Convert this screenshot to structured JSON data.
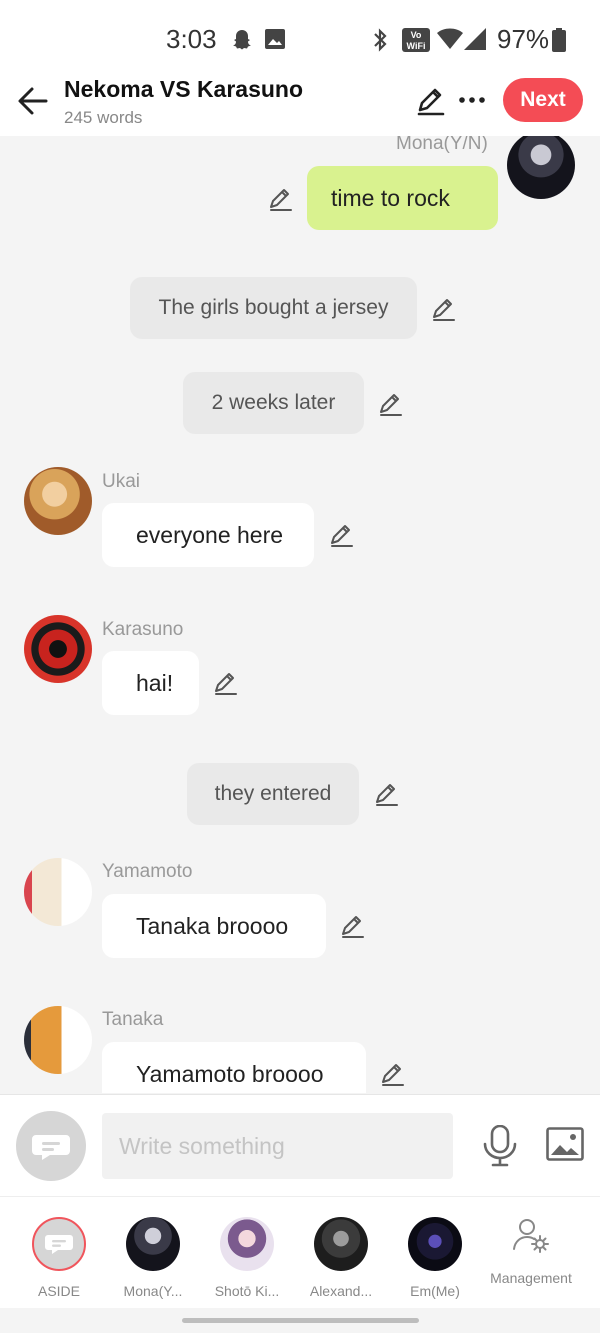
{
  "status": {
    "time": "3:03",
    "battery": "97%"
  },
  "header": {
    "title": "Nekoma VS Karasuno",
    "word_count": "245 words",
    "next_label": "Next"
  },
  "messages": {
    "m1": {
      "name": "Mona(Y/N)",
      "text": "time to rock"
    },
    "n1": {
      "text": "The girls bought a jersey"
    },
    "n2": {
      "text": "2 weeks later"
    },
    "m2": {
      "name": "Ukai",
      "text": "everyone here"
    },
    "m3": {
      "name": "Karasuno",
      "text": "hai!"
    },
    "n3": {
      "text": "they entered"
    },
    "m4": {
      "name": "Yamamoto",
      "text": "Tanaka broooo"
    },
    "m5": {
      "name": "Tanaka",
      "text": "Yamamoto broooo"
    }
  },
  "composer": {
    "placeholder": "Write something"
  },
  "characters": [
    {
      "label": "ASIDE"
    },
    {
      "label": "Mona(Y..."
    },
    {
      "label": "Shotō Ki..."
    },
    {
      "label": "Alexand..."
    },
    {
      "label": "Em(Me)"
    },
    {
      "label": "Management"
    }
  ],
  "colors": {
    "accent": "#f44c55",
    "my_bubble": "#d9f28f",
    "narration": "#e9e9e9",
    "background": "#f4f4f4"
  },
  "icons": [
    "snapchat-icon",
    "gallery-icon",
    "bluetooth-icon",
    "vowifi-icon",
    "wifi-icon",
    "signal-icon",
    "battery-icon",
    "back-arrow-icon",
    "pencil-icon",
    "more-icon",
    "edit-icon",
    "aside-icon",
    "mic-icon",
    "image-icon",
    "management-icon"
  ]
}
